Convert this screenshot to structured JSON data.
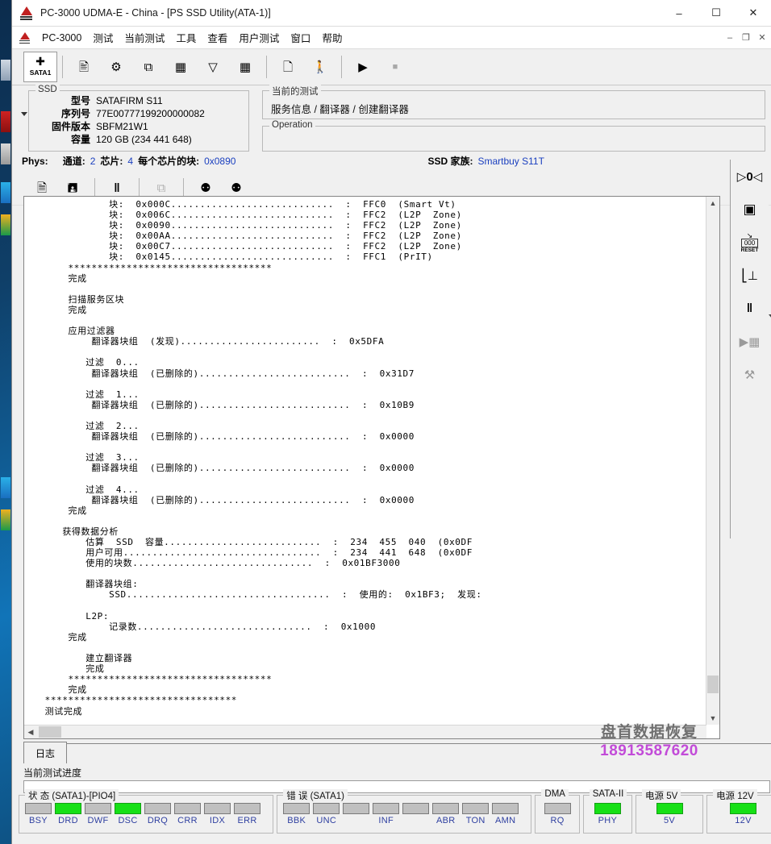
{
  "window": {
    "title": "PC-3000 UDMA-E - China - [PS SSD Utility(ATA-1)]",
    "minimize": "–",
    "maximize": "☐",
    "close": "✕"
  },
  "menubar": {
    "brand": "PC-3000",
    "items": [
      {
        "label": "测试"
      },
      {
        "label": "当前测试"
      },
      {
        "label": "工具"
      },
      {
        "label": "查看"
      },
      {
        "label": "用户测试"
      },
      {
        "label": "窗口"
      },
      {
        "label": "帮助"
      }
    ],
    "mdi": {
      "min": "–",
      "restore": "❐",
      "close": "✕"
    }
  },
  "toolbar": {
    "items": [
      {
        "name": "sata1-port-button",
        "icon": "SATA1",
        "selected": true
      },
      {
        "name": "drive-id-button",
        "icon": "☷"
      },
      {
        "name": "chip-utility-button",
        "icon": "⚙"
      },
      {
        "name": "copy-pages-button",
        "icon": "⧉"
      },
      {
        "name": "memory-map-button",
        "icon": "☲"
      },
      {
        "name": "graph-button",
        "icon": "▽"
      },
      {
        "name": "hex-grid-button",
        "icon": "▦"
      },
      {
        "name": "reports-button",
        "icon": "❐"
      },
      {
        "name": "run-tests-button",
        "icon": "⬛"
      },
      {
        "name": "start-button",
        "icon": "▶"
      },
      {
        "name": "stop-button",
        "icon": "■"
      }
    ]
  },
  "toolbar2": {
    "items": [
      {
        "name": "new-task-button",
        "icon": "⎘"
      },
      {
        "name": "save-task-button",
        "icon": "Ὃe"
      },
      {
        "name": "pause-button",
        "icon": "‖"
      },
      {
        "name": "copy-button",
        "icon": "⧉"
      },
      {
        "name": "find-button",
        "icon": "◖◗"
      },
      {
        "name": "find-next-button",
        "icon": "◖◗"
      }
    ]
  },
  "ssd_panel": {
    "caption": "SSD",
    "rows": [
      {
        "key": "型号",
        "value": "SATAFIRM    S11"
      },
      {
        "key": "序列号",
        "value": "77E00777199200000082"
      },
      {
        "key": "固件版本",
        "value": "SBFM21W1"
      },
      {
        "key": "容量",
        "value": "120 GB (234 441 648)"
      }
    ]
  },
  "current_test": {
    "caption": "当前的测试",
    "value": "服务信息 / 翻译器 / 创建翻译器"
  },
  "operation": {
    "caption": "Operation",
    "value": ""
  },
  "phys_row": {
    "label": "Phys:",
    "channel_label": "通道:",
    "channel_value": "2",
    "chip_label": "芯片:",
    "chip_value": "4",
    "blocks_label": "每个芯片的块:",
    "blocks_value": "0x0890",
    "family_label": "SSD 家族:",
    "family_value": "Smartbuy S11T"
  },
  "log": {
    "text": "              块:  0x000C............................  :  FFC0  (Smart Vt)\n              块:  0x006C............................  :  FFC2  (L2P  Zone)\n              块:  0x0090............................  :  FFC2  (L2P  Zone)\n              块:  0x00AA............................  :  FFC2  (L2P  Zone)\n              块:  0x00C7............................  :  FFC2  (L2P  Zone)\n              块:  0x0145............................  :  FFC1  (PrIT)\n       ***********************************\n       完成\n\n       扫描服务区块\n       完成\n\n       应用过滤器\n           翻译器块组  (发现)........................  :  0x5DFA\n\n          过滤  0...\n           翻译器块组  (已删除的)..........................  :  0x31D7\n\n          过滤  1...\n           翻译器块组  (已删除的)..........................  :  0x10B9\n\n          过滤  2...\n           翻译器块组  (已删除的)..........................  :  0x0000\n\n          过滤  3...\n           翻译器块组  (已删除的)..........................  :  0x0000\n\n          过滤  4...\n           翻译器块组  (已删除的)..........................  :  0x0000\n       完成\n\n      获得数据分析\n          估算  SSD  容量...........................  :  234  455  040  (0x0DF\n          用户可用..................................  :  234  441  648  (0x0DF\n          使用的块数...............................  :  0x01BF3000\n\n          翻译器块组:\n              SSD...................................  :  使用的:  0x1BF3;  发现:\n\n          L2P:\n              记录数..............................  :  0x1000\n       完成\n\n          建立翻译器\n          完成\n       ***********************************\n       完成\n   *********************************\n   测试完成\n"
  },
  "watermark": {
    "line1": "盘首数据恢复",
    "line2": "18913587620"
  },
  "right_toolbar": {
    "items": [
      {
        "name": "power-toggle-icon",
        "icon": "▷⬤◁"
      },
      {
        "name": "chip-board-icon",
        "icon": "⌸"
      },
      {
        "name": "reset-counter-icon",
        "icon": "RESET"
      },
      {
        "name": "ground-probe-icon",
        "icon": "⊥"
      },
      {
        "name": "pause-icon",
        "icon": "‖"
      },
      {
        "name": "run-chip-icon",
        "icon": "▶"
      },
      {
        "name": "tools-icon",
        "icon": "⚒"
      }
    ]
  },
  "tabs": {
    "items": [
      {
        "label": "日志",
        "active": true
      }
    ]
  },
  "progress": {
    "label": "当前测试进度",
    "percent": 0
  },
  "status_groups": [
    {
      "name": "status-sata1",
      "caption": "状 态 (SATA1)-[PIO4]",
      "leds": [
        {
          "label": "BSY",
          "on": false
        },
        {
          "label": "DRD",
          "on": true
        },
        {
          "label": "DWF",
          "on": false
        },
        {
          "label": "DSC",
          "on": true
        },
        {
          "label": "DRQ",
          "on": false
        },
        {
          "label": "CRR",
          "on": false
        },
        {
          "label": "IDX",
          "on": false
        },
        {
          "label": "ERR",
          "on": false
        }
      ]
    },
    {
      "name": "errors-sata1",
      "caption": "错 误 (SATA1)",
      "leds": [
        {
          "label": "BBK",
          "on": false
        },
        {
          "label": "UNC",
          "on": false
        },
        {
          "label": "",
          "on": false
        },
        {
          "label": "INF",
          "on": false
        },
        {
          "label": "",
          "on": false
        },
        {
          "label": "ABR",
          "on": false
        },
        {
          "label": "TON",
          "on": false
        },
        {
          "label": "AMN",
          "on": false
        }
      ]
    },
    {
      "name": "dma-group",
      "caption": "DMA",
      "leds": [
        {
          "label": "RQ",
          "on": false
        }
      ]
    },
    {
      "name": "sata2-group",
      "caption": "SATA-II",
      "leds": [
        {
          "label": "PHY",
          "on": true
        }
      ]
    },
    {
      "name": "power-5v-group",
      "caption": "电源 5V",
      "leds": [
        {
          "label": "5V",
          "on": true
        }
      ]
    },
    {
      "name": "power-12v-group",
      "caption": "电源 12V",
      "leds": [
        {
          "label": "12V",
          "on": true
        }
      ]
    }
  ],
  "colors": {
    "led_on": "#16e016",
    "led_off": "#c0c0c0",
    "accent_blue": "#1a3fbf",
    "watermark_purple": "#c24bd8"
  }
}
